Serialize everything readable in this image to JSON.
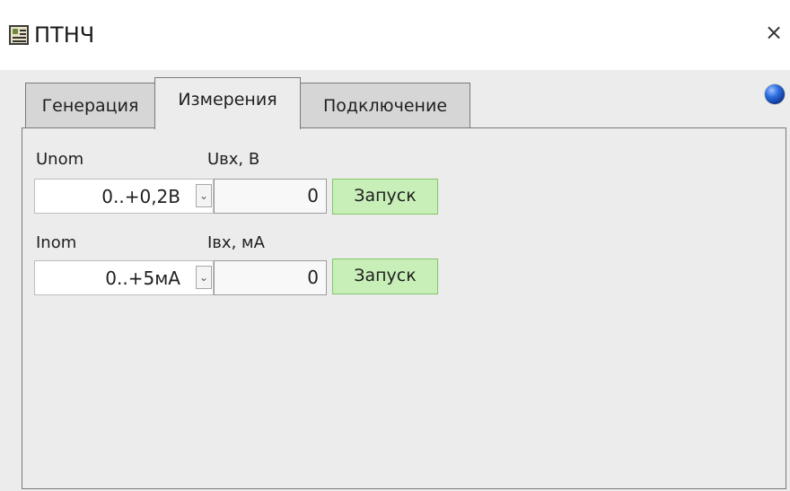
{
  "window": {
    "title": "ПТНЧ",
    "close_glyph": "×"
  },
  "tabs": [
    {
      "label": "Генерация",
      "active": false
    },
    {
      "label": "Измерения",
      "active": true
    },
    {
      "label": "Подключение",
      "active": false
    }
  ],
  "status_indicator": {
    "color": "#1f57c9"
  },
  "measurements": {
    "voltage": {
      "range_label": "Unom",
      "range_value": "0..+0,2В",
      "input_label": "Uвх, В",
      "input_value": "0",
      "start_label": "Запуск"
    },
    "current": {
      "range_label": "Inom",
      "range_value": "0..+5мА",
      "input_label": "Iвх, мА",
      "input_value": "0",
      "start_label": "Запуск"
    }
  },
  "icons": {
    "app": "app-window-icon",
    "close": "close-icon",
    "dropdown": "chevron-down-icon"
  },
  "colors": {
    "start_button_bg": "#c8efb8",
    "start_button_border": "#83c56b",
    "panel_bg": "#ececec"
  }
}
